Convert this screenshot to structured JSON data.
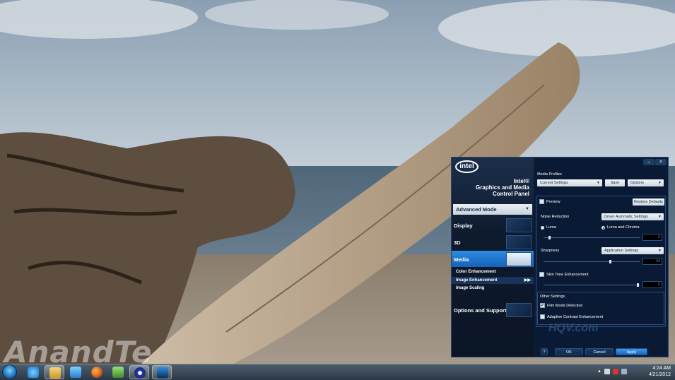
{
  "watermark": "AnandTe",
  "panel": {
    "brand_line1": "Intel®",
    "brand_line2": "Graphics and Media",
    "brand_line3": "Control Panel",
    "logo_text": "intel",
    "mode": "Advanced Mode",
    "nav": [
      {
        "label": "Display"
      },
      {
        "label": "3D"
      },
      {
        "label": "Media"
      },
      {
        "label": "Options and Support"
      }
    ],
    "media_sub": [
      {
        "label": "Color Enhancement"
      },
      {
        "label": "Image Enhancement"
      },
      {
        "label": "Image Scaling"
      }
    ],
    "media_profiles_label": "Media Profiles",
    "profile_value": "Current Settings",
    "save_label": "Save",
    "options_label": "Options",
    "preview_label": "Preview",
    "restore_label": "Restore Defaults",
    "noise_label": "Noise Reduction",
    "noise_value": "Driver Automatic Settings",
    "luma_label": "Luma",
    "luma_chroma_label": "Luma and Chroma",
    "noise_amount": "0",
    "sharpness_label": "Sharpness",
    "sharpness_value": "Application Settings",
    "sharpness_amount": "44",
    "skin_label": "Skin Tone Enhancement",
    "skin_amount": "5",
    "other_label": "Other Settings",
    "film_label": "Film Mode Detection",
    "adaptive_label": "Adaptive Contrast Enhancement",
    "hqv_text": "HQV.com",
    "help_label": "?",
    "ok_label": "OK",
    "cancel_label": "Cancel",
    "apply_label": "Apply",
    "minimize_label": "–",
    "close_label": "×"
  },
  "tray": {
    "time": "4:24 AM",
    "date": "4/21/2012"
  }
}
